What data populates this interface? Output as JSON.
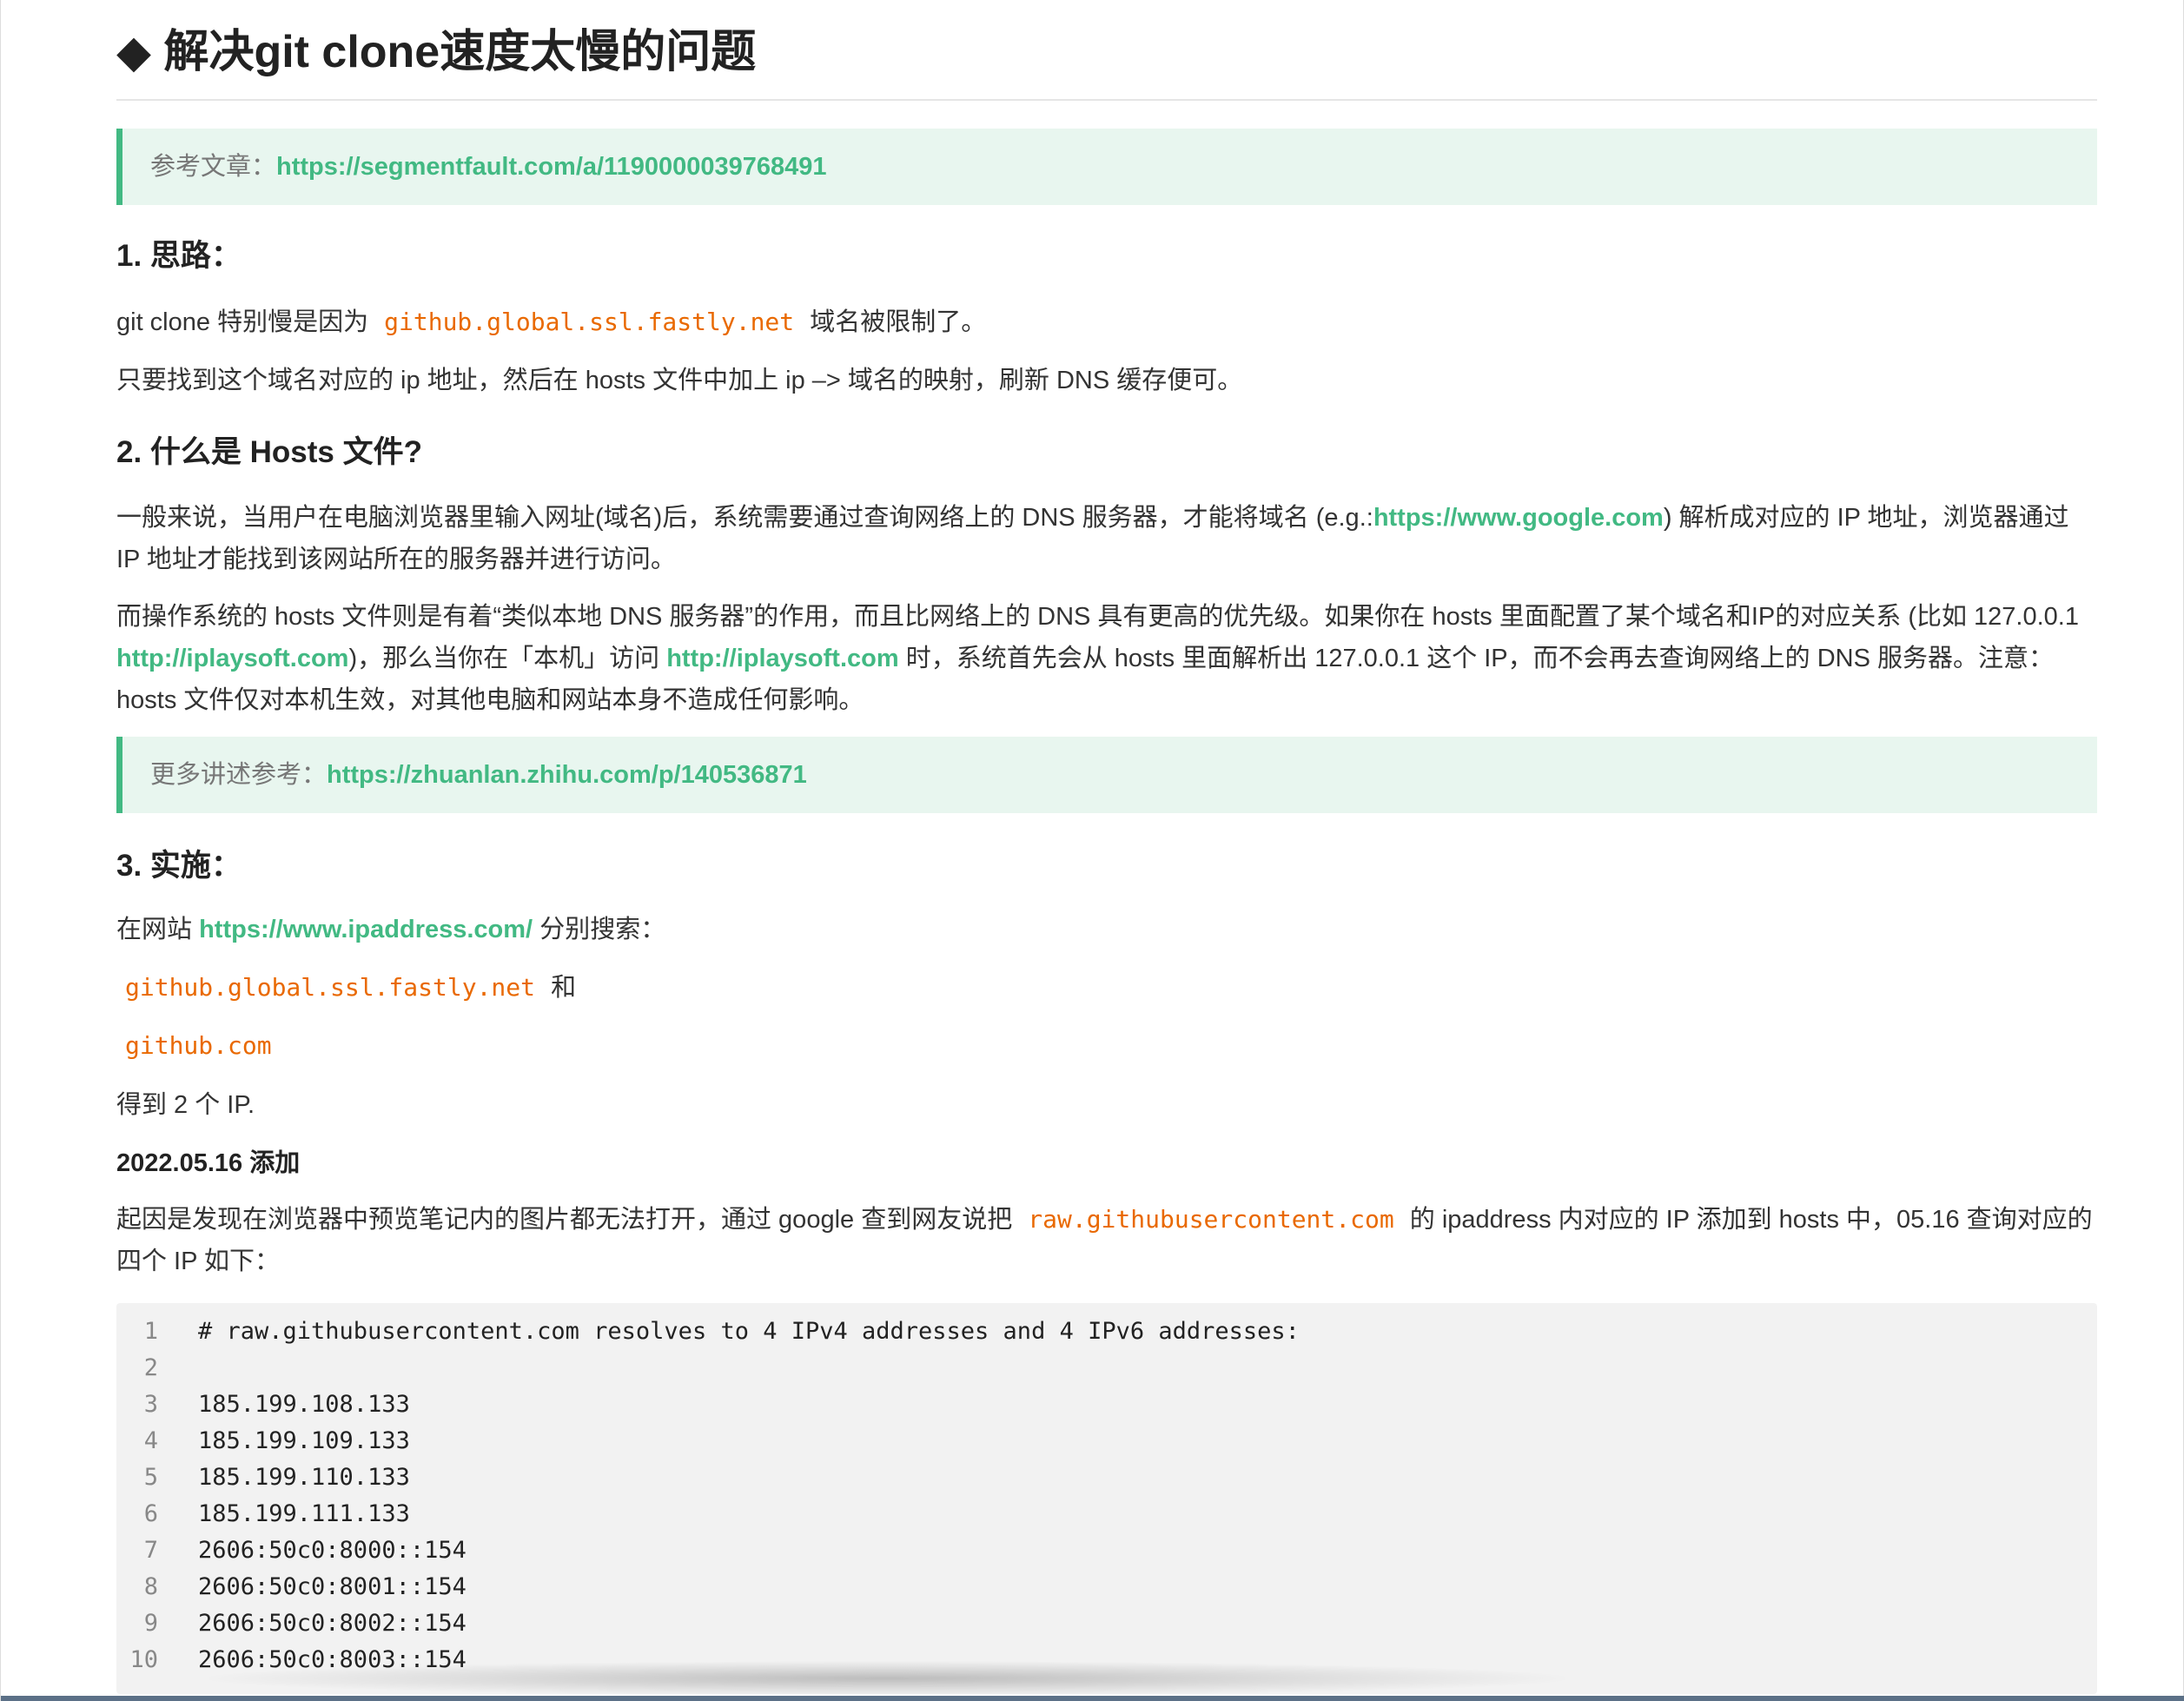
{
  "title": "◆ 解决git clone速度太慢的问题",
  "ref1": {
    "label": "参考文章：",
    "link": "https://segmentfault.com/a/1190000039768491"
  },
  "s1": {
    "heading": "1. 思路：",
    "p1_before": "git clone 特别慢是因为",
    "p1_code": "github.global.ssl.fastly.net",
    "p1_after": "域名被限制了。",
    "p2": "只要找到这个域名对应的 ip 地址，然后在 hosts 文件中加上 ip –> 域名的映射，刷新 DNS 缓存便可。"
  },
  "s2": {
    "heading": "2. 什么是 Hosts 文件?",
    "p1_before": "一般来说，当用户在电脑浏览器里输入网址(域名)后，系统需要通过查询网络上的 DNS 服务器，才能将域名 (e.g.:",
    "p1_link": "https://www.google.com",
    "p1_after": ") 解析成对应的 IP 地址，浏览器通过 IP 地址才能找到该网站所在的服务器并进行访问。",
    "p2_a": "而操作系统的 hosts 文件则是有着“类似本地 DNS 服务器”的作用，而且比网络上的 DNS 具有更高的优先级。如果你在 hosts 里面配置了某个域名和IP的对应关系 (比如 127.0.0.1",
    "p2_link1": "http://iplaysoft.com",
    "p2_b": ")，那么当你在「本机」访问",
    "p2_link2": "http://iplaysoft.com",
    "p2_c": "时，系统首先会从 hosts 里面解析出 127.0.0.1 这个 IP，而不会再去查询网络上的 DNS 服务器。注意：hosts 文件仅对本机生效，对其他电脑和网站本身不造成任何影响。"
  },
  "ref2": {
    "label": "更多讲述参考：",
    "link": "https://zhuanlan.zhihu.com/p/140536871"
  },
  "s3": {
    "heading": "3. 实施：",
    "p1_before": "在网站",
    "p1_link": "https://www.ipaddress.com/",
    "p1_after": "分别搜索：",
    "code1": "github.global.ssl.fastly.net",
    "and": "和",
    "code2": "github.com",
    "p_result": "得到 2 个 IP.",
    "update_title": "2022.05.16 添加",
    "p_update_before": "起因是发现在浏览器中预览笔记内的图片都无法打开，通过 google 查到网友说把",
    "p_update_code": "raw.githubusercontent.com",
    "p_update_after": "的 ipaddress 内对应的 IP 添加到 hosts 中，05.16 查询对应的四个 IP 如下："
  },
  "code_lines": [
    {
      "n": "1",
      "text": "# raw.githubusercontent.com resolves to 4 IPv4 addresses and 4 IPv6 addresses:"
    },
    {
      "n": "2",
      "text": ""
    },
    {
      "n": "3",
      "text": "185.199.108.133"
    },
    {
      "n": "4",
      "text": "185.199.109.133"
    },
    {
      "n": "5",
      "text": "185.199.110.133"
    },
    {
      "n": "6",
      "text": "185.199.111.133"
    },
    {
      "n": "7",
      "text": "2606:50c0:8000::154"
    },
    {
      "n": "8",
      "text": "2606:50c0:8001::154"
    },
    {
      "n": "9",
      "text": "2606:50c0:8002::154"
    },
    {
      "n": "10",
      "text": "2606:50c0:8003::154"
    }
  ]
}
